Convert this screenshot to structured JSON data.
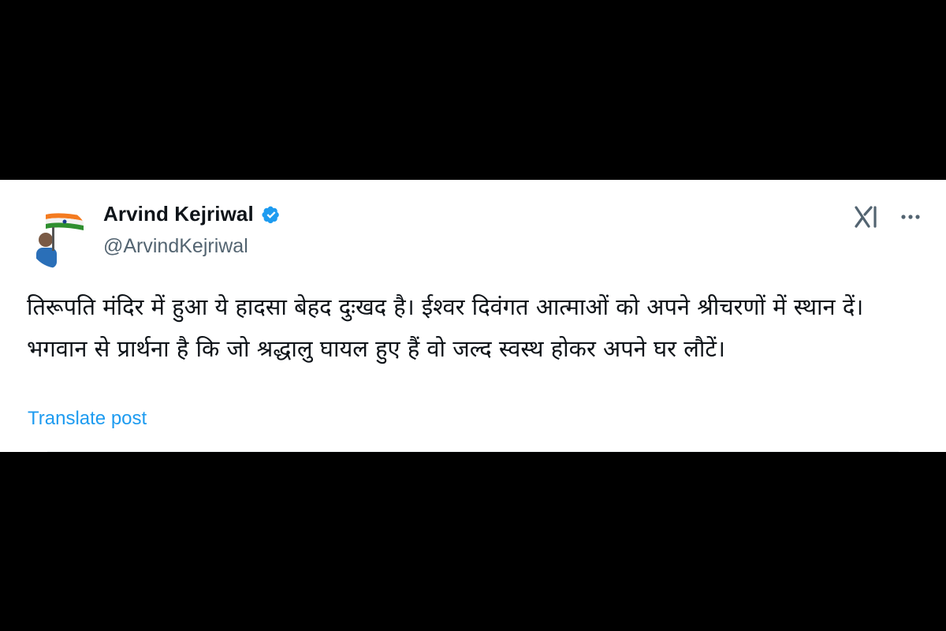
{
  "post": {
    "author_name": "Arvind Kejriwal",
    "author_handle": "@ArvindKejriwal",
    "verified": true,
    "text": "तिरूपति मंदिर में हुआ ये हादसा बेहद दुःखद है। ईश्वर दिवंगत आत्माओं को अपने श्रीचरणों में स्थान दें। भगवान से प्रार्थना है कि जो श्रद्धालु घायल हुए हैं वो जल्द स्वस्थ होकर अपने घर लौटें।",
    "translate_label": "Translate post"
  },
  "icons": {
    "avatar": "profile-photo-with-tricolor-flag",
    "verified": "verified-badge-icon",
    "grok": "xai-grok-icon",
    "more": "more-options-icon"
  },
  "colors": {
    "background": "#000000",
    "card": "#ffffff",
    "name": "#0f1419",
    "handle": "#536471",
    "link": "#1d9bf0",
    "verified": "#1d9bf0"
  }
}
